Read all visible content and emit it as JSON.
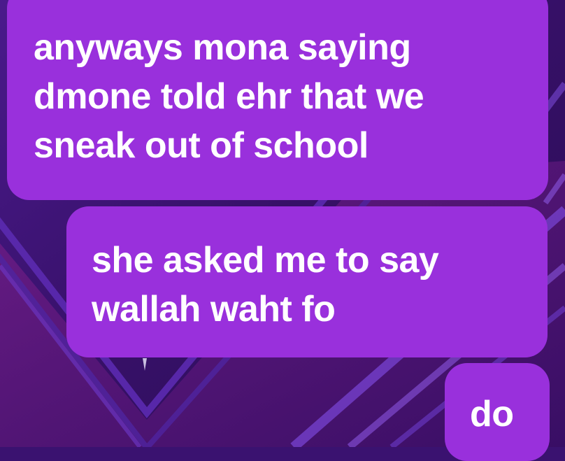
{
  "theme": {
    "bubble_color": "#9930dc",
    "text_color": "#ffffff",
    "wallpaper_base": "#3a1270"
  },
  "messages": [
    {
      "lines": [
        "anyways mona saying",
        "dmone told ehr that we",
        "sneak out of school"
      ]
    },
    {
      "lines": [
        "she asked me to say",
        "wallah waht fo"
      ]
    },
    {
      "lines": [
        "do"
      ]
    }
  ]
}
